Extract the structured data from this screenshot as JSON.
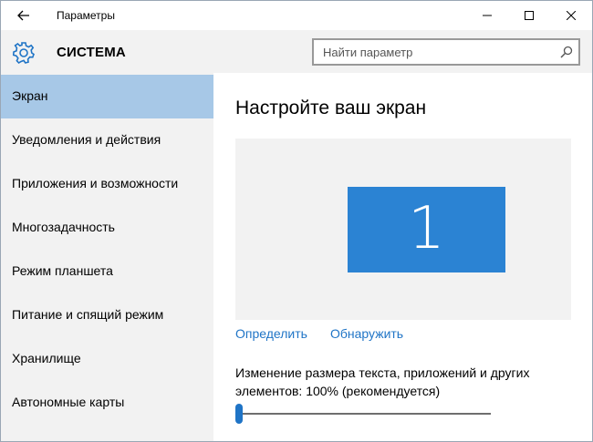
{
  "window": {
    "title": "Параметры"
  },
  "header": {
    "section_title": "СИСТЕМА",
    "search_placeholder": "Найти параметр"
  },
  "sidebar": {
    "items": [
      {
        "label": "Экран",
        "active": true
      },
      {
        "label": "Уведомления и действия",
        "active": false
      },
      {
        "label": "Приложения и возможности",
        "active": false
      },
      {
        "label": "Многозадачность",
        "active": false
      },
      {
        "label": "Режим планшета",
        "active": false
      },
      {
        "label": "Питание и спящий режим",
        "active": false
      },
      {
        "label": "Хранилище",
        "active": false
      },
      {
        "label": "Автономные карты",
        "active": false
      }
    ]
  },
  "main": {
    "title": "Настройте ваш экран",
    "monitor_number": "1",
    "identify_link": "Определить",
    "detect_link": "Обнаружить",
    "scale_label": "Изменение размера текста, приложений и других элементов: 100% (рекомендуется)",
    "scale_slider_fraction": 0
  },
  "colors": {
    "accent": "#1f74c6",
    "monitor": "#2b83d3",
    "selected_nav": "#a7c8e7",
    "panel_bg": "#f2f2f2"
  },
  "icons": {
    "back": "arrow-left-icon",
    "gear": "gear-icon",
    "search": "search-icon",
    "minimize": "minimize-icon",
    "maximize": "maximize-icon",
    "close": "close-icon"
  }
}
